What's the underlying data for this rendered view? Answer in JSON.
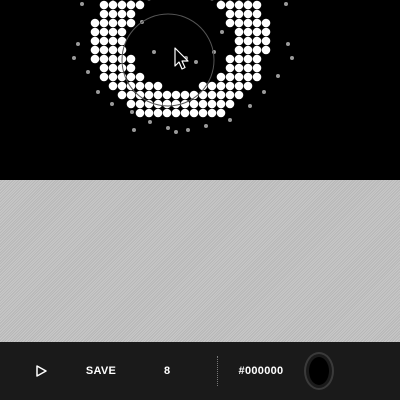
{
  "toolbar": {
    "play_icon": "play-outline-icon",
    "save_label": "SAVE",
    "brush_size": "8",
    "color_hex": "#000000",
    "swatch_color": "#000000"
  },
  "canvas": {
    "background": "#000000",
    "dot_color": "#ffffff",
    "cursor_icon": "arrow-cursor-icon"
  },
  "paper": {
    "color": "#c2c2c2"
  }
}
